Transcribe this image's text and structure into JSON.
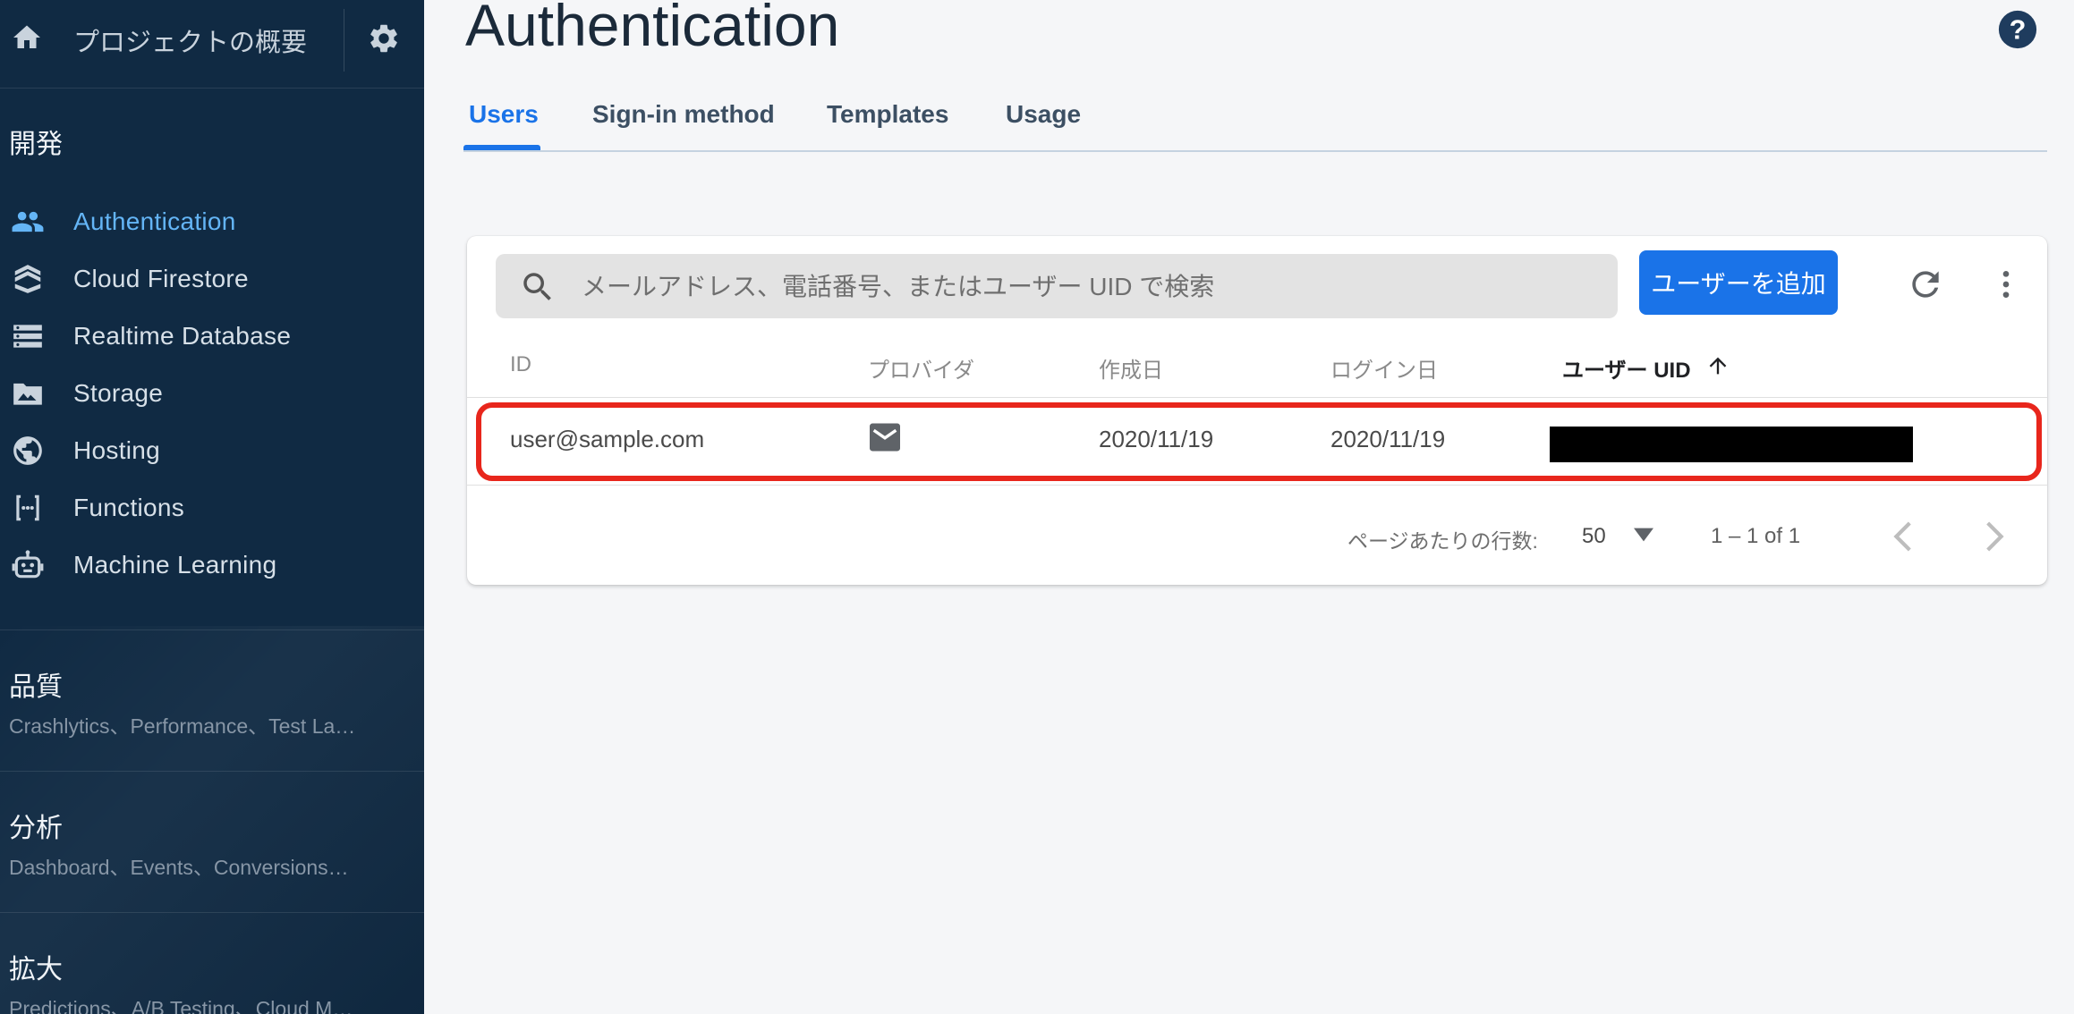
{
  "sidebar": {
    "project_overview": "プロジェクトの概要",
    "section_develop": "開発",
    "items": [
      {
        "label": "Authentication",
        "icon": "people-icon",
        "active": true
      },
      {
        "label": "Cloud Firestore",
        "icon": "firestore-icon"
      },
      {
        "label": "Realtime Database",
        "icon": "database-icon"
      },
      {
        "label": "Storage",
        "icon": "photo-storage-icon"
      },
      {
        "label": "Hosting",
        "icon": "globe-icon"
      },
      {
        "label": "Functions",
        "icon": "functions-icon"
      },
      {
        "label": "Machine Learning",
        "icon": "robot-icon"
      }
    ],
    "groups": [
      {
        "title": "品質",
        "subtitle": "Crashlytics、Performance、Test La…"
      },
      {
        "title": "分析",
        "subtitle": "Dashboard、Events、Conversions…"
      },
      {
        "title": "拡大",
        "subtitle": "Predictions、A/B Testing、Cloud M…"
      }
    ]
  },
  "main": {
    "title": "Authentication",
    "tabs": [
      {
        "label": "Users",
        "active": true
      },
      {
        "label": "Sign-in method"
      },
      {
        "label": "Templates"
      },
      {
        "label": "Usage"
      }
    ],
    "search": {
      "placeholder": "メールアドレス、電話番号、またはユーザー UID で検索",
      "value": ""
    },
    "add_user_label": "ユーザーを追加",
    "columns": [
      "ID",
      "プロバイダ",
      "作成日",
      "ログイン日",
      "ユーザー UID"
    ],
    "sorted_column": "ユーザー UID",
    "rows": [
      {
        "id": "user@sample.com",
        "provider": "mail-icon",
        "created": "2020/11/19",
        "signed_in": "2020/11/19",
        "uid": ""
      }
    ],
    "pagination": {
      "rows_per_page_label": "ページあたりの行数:",
      "rows_per_page": "50",
      "range": "1 – 1 of 1"
    }
  },
  "colors": {
    "sidebar_bg": "#102a43",
    "accent": "#1a73e8",
    "active_nav": "#64b5f6",
    "highlight": "#e8261c"
  }
}
